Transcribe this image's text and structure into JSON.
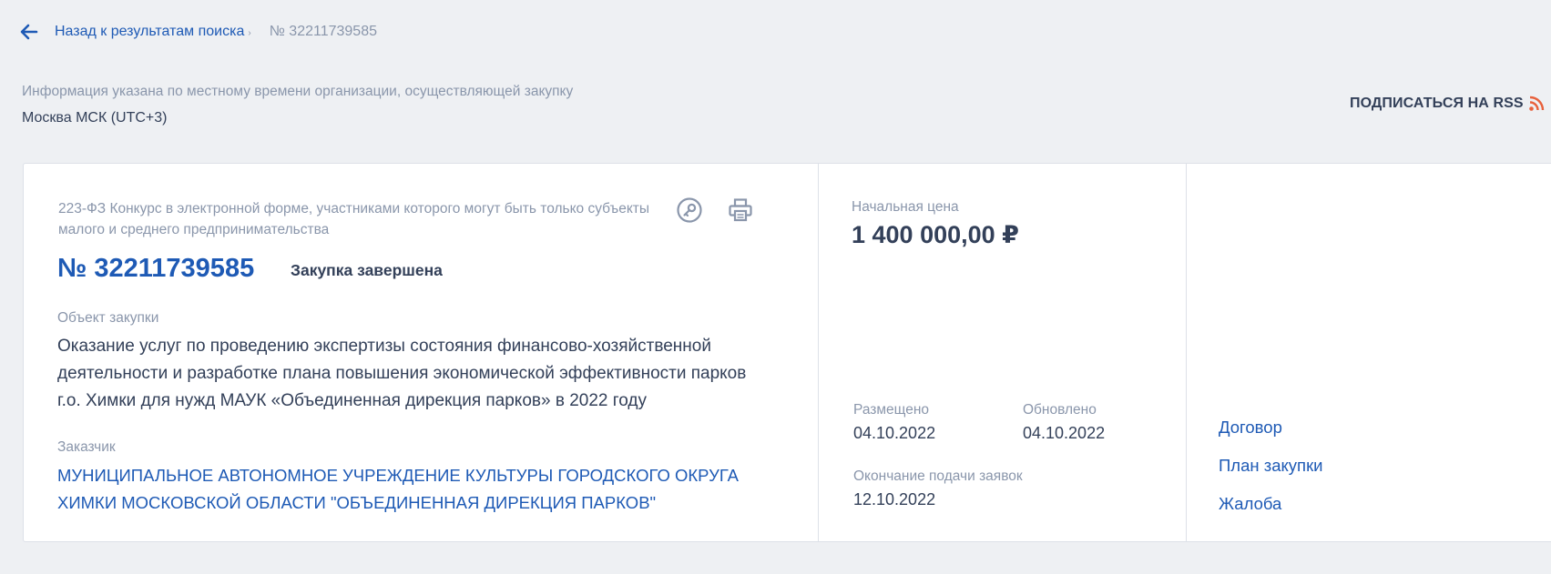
{
  "breadcrumb": {
    "back_label": "Назад к результатам поиска",
    "separator": "›",
    "current": "№ 32211739585"
  },
  "timezone": {
    "note": "Информация указана по местному времени организации, осуществляющей закупку",
    "value": "Москва МСК (UTC+3)"
  },
  "rss": {
    "label": "ПОДПИСАТЬСЯ НА RSS"
  },
  "purchase": {
    "type": "223-ФЗ Конкурс в электронной форме, участниками которого могут быть только субъекты малого и среднего предпринимательства",
    "number": "№ 32211739585",
    "status": "Закупка завершена",
    "object_label": "Объект закупки",
    "object": "Оказание услуг по проведению экспертизы состояния финансово-хозяйственной деятельности и разработке плана повышения экономической эффективности парков г.о. Химки для нужд МАУК «Объединенная дирекция парков» в 2022 году",
    "customer_label": "Заказчик",
    "customer": "МУНИЦИПАЛЬНОЕ АВТОНОМНОЕ УЧРЕЖДЕНИЕ КУЛЬТУРЫ ГОРОДСКОГО ОКРУГА ХИМКИ МОСКОВСКОЙ ОБЛАСТИ \"ОБЪЕДИНЕННАЯ ДИРЕКЦИЯ ПАРКОВ\""
  },
  "price": {
    "label": "Начальная цена",
    "value": "1 400 000,00 ₽"
  },
  "dates": {
    "posted_label": "Размещено",
    "posted": "04.10.2022",
    "updated_label": "Обновлено",
    "updated": "04.10.2022",
    "deadline_label": "Окончание подачи заявок",
    "deadline": "12.10.2022"
  },
  "links": [
    {
      "label": "Договор"
    },
    {
      "label": "План закупки"
    },
    {
      "label": "Жалоба"
    }
  ],
  "icons": {
    "back": "arrow-left-icon",
    "history": "key-icon",
    "print": "printer-icon",
    "rss": "rss-icon"
  },
  "colors": {
    "link": "#1e5ab5",
    "muted": "#8a96ab",
    "text": "#334059",
    "rss": "#e8613c",
    "background": "#eef0f3"
  }
}
